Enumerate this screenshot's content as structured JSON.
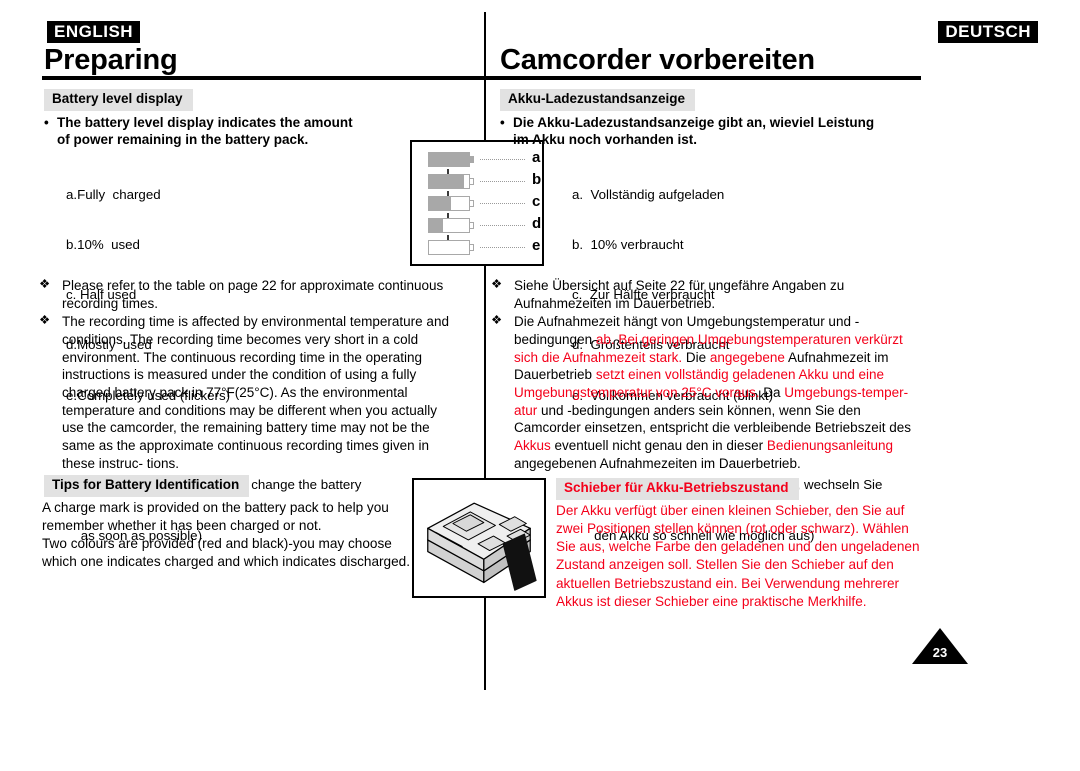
{
  "colors": {
    "red": "#f4001a",
    "grey_bar": "#e2e2e2",
    "battery_grey": "#a8a8a8"
  },
  "header": {
    "badge_en": "ENGLISH",
    "badge_de": "DEUTSCH",
    "title_en": "Preparing",
    "title_de": "Camcorder vorbereiten"
  },
  "english": {
    "section1_heading": "Battery level display",
    "section1_lead_bullet": "•",
    "section1_lead_line1": "The battery level display indicates the amount",
    "section1_lead_line2": "of power remaining in the battery pack.",
    "level_list": [
      "a.Fully  charged",
      "b.10%  used",
      "c. Half used",
      "d.Mostly  used",
      "e.Completely used (flickers)",
      "   (camcorder will turn off soon, change the battery",
      "    as soon as possible)"
    ],
    "bullets": [
      "Please refer to the table on page 22 for approximate continuous recording times.",
      "The recording time is affected by environmental temperature and conditions. The recording time becomes very short in a cold environment. The continuous recording time in the operating instructions is measured under the condition of using a fully charged battery pack in 77°F(25°C). As the environmental temperature and conditions may be different when you actually use the camcorder, the remaining battery time may not be the same as the approximate continuous recording times given in these instruc- tions."
    ],
    "section2_heading": "Tips for Battery Identification",
    "section2_lines": [
      "A charge mark is provided on the battery pack to help you",
      "remember whether it has been charged or not.",
      "Two colours are provided (red and black)-you may choose",
      "which one indicates charged and which indicates discharged."
    ]
  },
  "german": {
    "section1_heading": "Akku-Ladezustandsanzeige",
    "section1_lead_bullet": "•",
    "section1_lead_line1": "Die Akku-Ladezustandsanzeige gibt an, wieviel Leistung",
    "section1_lead_line2": "im Akku noch vorhanden ist.",
    "level_list": [
      "a.  Vollständig aufgeladen",
      "b.  10% verbraucht",
      "c.  Zur Hälfte verbraucht",
      "d.  Größtenteils verbraucht",
      "e.  Vollkommen verbraucht (blinkt)",
      "     (Camcorder wird bald abgeschaltet, wechseln Sie",
      "      den Akku so schnell wie möglich aus)"
    ],
    "bullet1": "Siehe Übersicht auf Seite 22 für ungefähre Angaben zu Aufnahmezeiten im Dauerbetrieb.",
    "bullet2_runs": [
      {
        "t": "Die Aufnahmezeit hängt von Umgebungstemperatur und - bedingungen ",
        "c": "black"
      },
      {
        "t": "ab. Bei geringen Umgebungstemperaturen verkürzt sich die Aufnahmezeit stark. ",
        "c": "red"
      },
      {
        "t": "Die ",
        "c": "black"
      },
      {
        "t": "angegebene ",
        "c": "red"
      },
      {
        "t": "Aufnahmezeit im Dauerbetrieb ",
        "c": "black"
      },
      {
        "t": "setzt einen vollständig geladenen Akku und eine Umgebungstemperatur von 25°C voraus. ",
        "c": "red"
      },
      {
        "t": "Da ",
        "c": "black"
      },
      {
        "t": "Umgebungs-temper- atur ",
        "c": "red"
      },
      {
        "t": "und -bedingungen anders sein können, wenn Sie den Camcorder einsetzen, entspricht die verbleibende Betriebszeit des ",
        "c": "black"
      },
      {
        "t": "Akkus ",
        "c": "red"
      },
      {
        "t": "eventuell nicht genau den in dieser ",
        "c": "black"
      },
      {
        "t": "Bedienungsanleitung ",
        "c": "red"
      },
      {
        "t": "angegebenen Aufnahmezeiten im Dauerbetrieb.",
        "c": "black"
      }
    ],
    "section2_heading": "Schieber für Akku-Betriebszustand",
    "section2_lines": [
      "Der Akku verfügt über einen kleinen Schieber, den Sie auf",
      "zwei Positionen stellen können (rot oder schwarz). Wählen",
      "Sie aus, welche Farbe den geladenen und den ungeladenen",
      "Zustand anzeigen soll. Stellen Sie den Schieber auf den",
      "aktuellen Betriebszustand ein. Bei Verwendung mehrerer",
      "Akkus ist dieser Schieber eine praktische Merkhilfe."
    ]
  },
  "battery_figure": {
    "rows": [
      {
        "letter": "a",
        "fill_percent": 100
      },
      {
        "letter": "b",
        "fill_percent": 88
      },
      {
        "letter": "c",
        "fill_percent": 55
      },
      {
        "letter": "d",
        "fill_percent": 36
      },
      {
        "letter": "e",
        "fill_percent": 0
      }
    ]
  },
  "footer": {
    "page_number": "23"
  }
}
